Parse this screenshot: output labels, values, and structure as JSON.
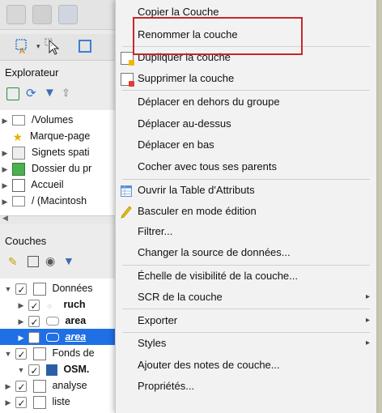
{
  "explorer": {
    "title": "Explorateur",
    "items": [
      {
        "label": "/Volumes"
      },
      {
        "label": "Marque-page"
      },
      {
        "label": "Signets spati"
      },
      {
        "label": "Dossier du pr"
      },
      {
        "label": "Accueil"
      },
      {
        "label": "/ (Macintosh"
      }
    ]
  },
  "layers": {
    "title": "Couches",
    "items": [
      {
        "label": "Données"
      },
      {
        "label": "ruch"
      },
      {
        "label": "area"
      },
      {
        "label": "area"
      },
      {
        "label": "Fonds de"
      },
      {
        "label": "OSM."
      },
      {
        "label": "analyse"
      },
      {
        "label": "liste"
      }
    ]
  },
  "menu": {
    "items": [
      {
        "label": "Copier la Couche"
      },
      {
        "label": "Renommer la couche"
      },
      {
        "label": "Dupliquer la couche"
      },
      {
        "label": "Supprimer la couche"
      },
      {
        "label": "Déplacer en dehors du groupe"
      },
      {
        "label": "Déplacer au-dessus"
      },
      {
        "label": "Déplacer en bas"
      },
      {
        "label": "Cocher avec tous ses parents"
      },
      {
        "label": "Ouvrir la Table d'Attributs"
      },
      {
        "label": "Basculer en mode édition"
      },
      {
        "label": "Filtrer..."
      },
      {
        "label": "Changer la source de données..."
      },
      {
        "label": "Échelle de visibilité de la couche..."
      },
      {
        "label": "SCR de la couche"
      },
      {
        "label": "Exporter"
      },
      {
        "label": "Styles"
      },
      {
        "label": "Ajouter des notes de couche..."
      },
      {
        "label": "Propriétés..."
      }
    ],
    "submenu_arrow": "▸"
  },
  "colors": {
    "highlight_border": "#c62828",
    "selected_row": "#1f6fe5",
    "menu_bg": "#f2f2f2"
  }
}
